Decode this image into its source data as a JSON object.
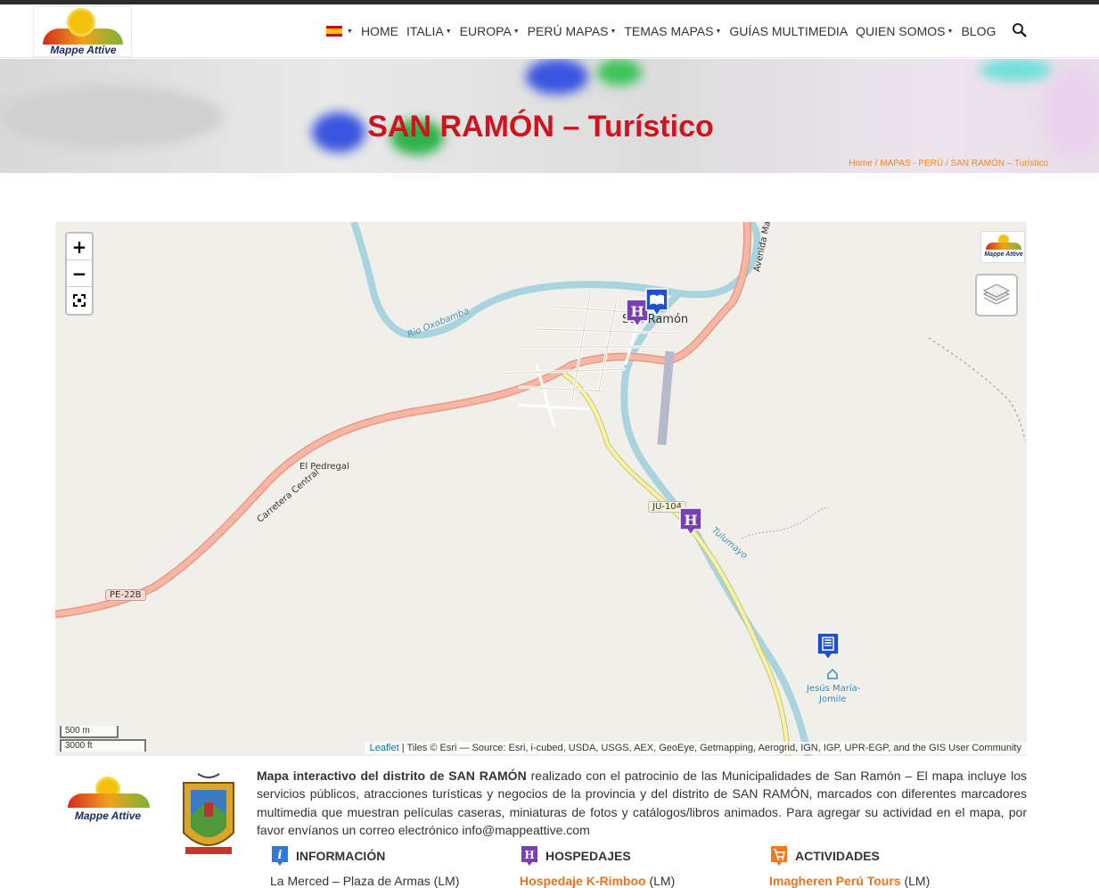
{
  "header": {
    "logo_text": "Mappe Attive",
    "nav": [
      {
        "label": "HOME",
        "dropdown": false
      },
      {
        "label": "ITALIA",
        "dropdown": true
      },
      {
        "label": "EUROPA",
        "dropdown": true
      },
      {
        "label": "PERÚ MAPAS",
        "dropdown": true
      },
      {
        "label": "TEMAS MAPAS",
        "dropdown": true
      },
      {
        "label": "GUÍAS MULTIMEDIA",
        "dropdown": false
      },
      {
        "label": "QUIEN SOMOS",
        "dropdown": true
      },
      {
        "label": "BLOG",
        "dropdown": false
      }
    ],
    "language_flag": "es-flag-icon",
    "search_icon": "search-icon"
  },
  "hero": {
    "title": "SAN RAMÓN – Turístico",
    "breadcrumb": "Home / MAPAS - PERÚ / SAN RAMÓN – Turístico"
  },
  "map": {
    "zoom_in": "+",
    "zoom_out": "−",
    "fullscreen_icon": "fullscreen-icon",
    "layers_icon": "layers-icon",
    "mini_logo_text": "Mappe Attive",
    "labels": {
      "town": "San Ramón",
      "river_1": "Rio Oxobamba",
      "river_2": "Tulumayo",
      "avenue": "Avenida Mar",
      "place_1": "El Pedregal",
      "road_1": "Carretera Central",
      "place_2_line1": "Jesús María-",
      "place_2_line2": "Jomile"
    },
    "shields": [
      "JU-104",
      "PE-22B"
    ],
    "scale": {
      "metric": "500 m",
      "imperial": "3000 ft"
    },
    "attribution": {
      "link": "Leaflet",
      "text": " | Tiles © Esri — Source: Esri, i-cubed, USDA, USGS, AEX, GeoEye, Getmapping, Aerogrid, IGN, IGP, UPR-EGP, and the GIS User Community"
    },
    "colors": {
      "hotel_marker": "#7b3fb5",
      "book_marker": "#1d4fd1",
      "river": "#a9d3de",
      "road_primary": "#f29a85",
      "road_secondary": "#f5f2a0"
    }
  },
  "footer": {
    "logo_text": "Mappe Attive",
    "desc_bold": "Mapa interactivo del distrito de SAN RAMÓN",
    "desc_rest": " realizado con el patrocinio de las Municipalidades de San Ramón – El mapa incluye los servicios públicos, atracciones turísticas y negocios de la provincia y del distrito de SAN RAMÓN, marcados con diferentes marcadores multimedia que muestran películas caseras, miniaturas de fotos y catálogos/libros animados. Para agregar su actividad en el mapa, por favor envíanos un correo electrónico info@mappeattive.com",
    "categories": [
      {
        "title": "INFORMACIÓN",
        "icon": "info-icon",
        "entry_name": "La Merced – Plaza de Armas",
        "entry_suffix": " (LM)",
        "link": false
      },
      {
        "title": "HOSPEDAJES",
        "icon": "hotel-icon",
        "entry_name": "Hospedaje K-Rimboo",
        "entry_suffix": " (LM)",
        "link": true
      },
      {
        "title": "ACTIVIDADES",
        "icon": "shopping-cart-icon",
        "entry_name": "Imagheren Perú Tours",
        "entry_suffix": " (LM)",
        "link": true
      }
    ]
  }
}
